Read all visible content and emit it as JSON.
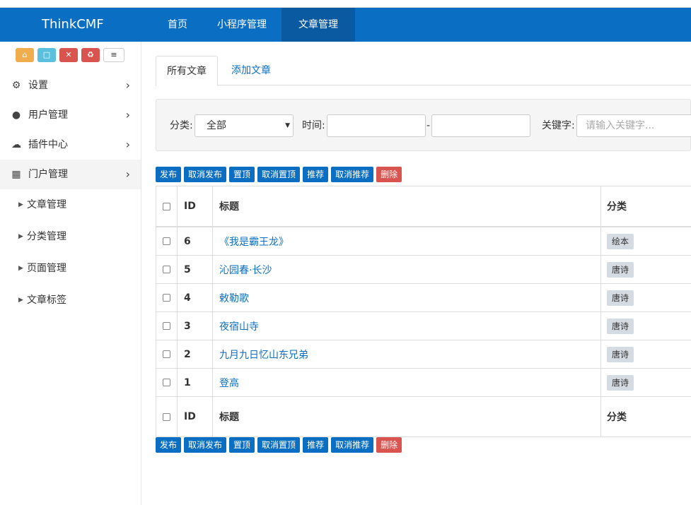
{
  "app": {
    "brand": "ThinkCMF"
  },
  "topnav": [
    {
      "label": "首页",
      "active": false
    },
    {
      "label": "小程序管理",
      "active": false
    },
    {
      "label": "文章管理",
      "active": true
    }
  ],
  "sidebar": {
    "shortcuts": [
      {
        "icon": "home-icon",
        "color": "#f0ad4e"
      },
      {
        "icon": "file-icon",
        "color": "#5bc0de"
      },
      {
        "icon": "trash-icon",
        "color": "#d9534f"
      },
      {
        "icon": "recycle-icon",
        "color": "#d9534f"
      },
      {
        "icon": "list-icon",
        "color": "#ffffff"
      }
    ],
    "items": [
      {
        "label": "设置",
        "icon": "gears-icon"
      },
      {
        "label": "用户管理",
        "icon": "users-icon"
      },
      {
        "label": "插件中心",
        "icon": "cloud-icon"
      },
      {
        "label": "门户管理",
        "icon": "grid-icon"
      }
    ],
    "subitems": [
      {
        "label": "文章管理"
      },
      {
        "label": "分类管理"
      },
      {
        "label": "页面管理"
      },
      {
        "label": "文章标签"
      }
    ]
  },
  "tabs": {
    "all": "所有文章",
    "add": "添加文章"
  },
  "filter": {
    "category_label": "分类:",
    "category_value": "全部",
    "time_label": "时间:",
    "time_separator": "-",
    "keyword_label": "关键字:",
    "keyword_placeholder": "请输入关键字..."
  },
  "actions": [
    "发布",
    "取消发布",
    "置顶",
    "取消置顶",
    "推荐",
    "取消推荐",
    "删除"
  ],
  "table": {
    "headers": {
      "id": "ID",
      "title": "标题",
      "category": "分类"
    },
    "rows": [
      {
        "id": "6",
        "title": "《我是霸王龙》",
        "category": "绘本"
      },
      {
        "id": "5",
        "title": "沁园春·长沙",
        "category": "唐诗"
      },
      {
        "id": "4",
        "title": "敕勒歌",
        "category": "唐诗"
      },
      {
        "id": "3",
        "title": "夜宿山寺",
        "category": "唐诗"
      },
      {
        "id": "2",
        "title": "九月九日忆山东兄弟",
        "category": "唐诗"
      },
      {
        "id": "1",
        "title": "登高",
        "category": "唐诗"
      }
    ]
  },
  "colors": {
    "primary": "#0a6fc2",
    "danger": "#d9534f"
  }
}
